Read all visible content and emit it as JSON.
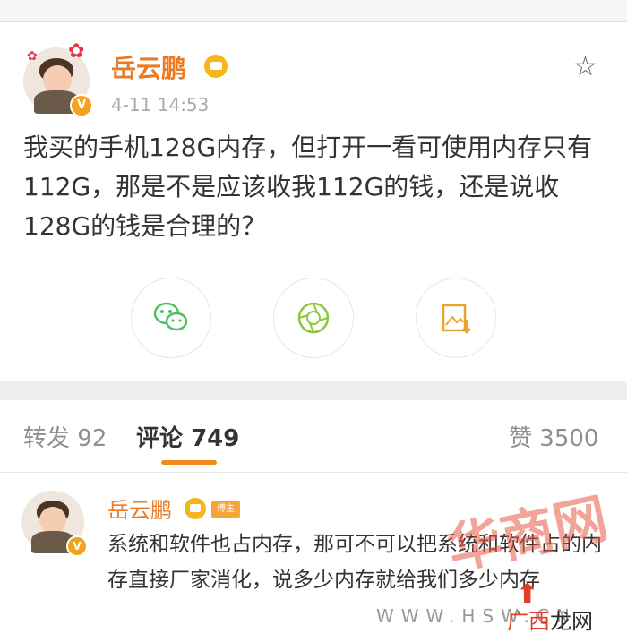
{
  "post": {
    "username": "岳云鹏",
    "time": "4-11 14:53",
    "content": "我买的手机128G内存，但打开一看可使用内存只有112G，那是不是应该收我112G的钱，还是说收128G的钱是合理的？",
    "verified_mark": "V",
    "share_icons": [
      "wechat-icon",
      "moments-icon",
      "save-image-icon"
    ],
    "accent_color": "#ea7a23"
  },
  "tabs": {
    "repost_label": "转发",
    "repost_count": "92",
    "comment_label": "评论",
    "comment_count": "749",
    "like_label": "赞",
    "like_count": "3500"
  },
  "comment": {
    "username": "岳云鹏",
    "host_badge": "博主",
    "verified_mark": "V",
    "text": "系统和软件也占内存，那可不可以把系统和软件占的内存直接厂家消化，说多少内存就给我们多少内存"
  },
  "watermark": {
    "main": "华商网",
    "url": "WWW.HSW.CN",
    "site_part1": "广西",
    "site_part2": "龙网",
    "logo": "⬆"
  }
}
